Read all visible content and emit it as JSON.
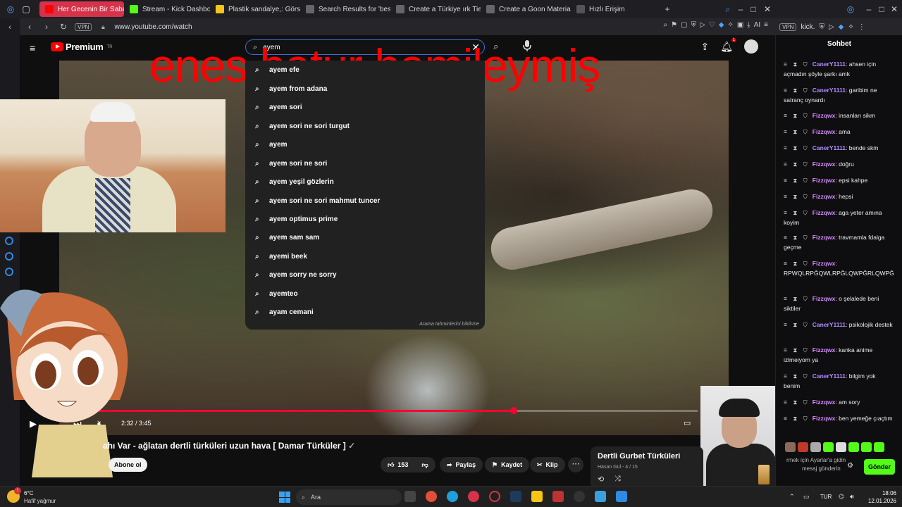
{
  "browser": {
    "tabs": [
      {
        "label": "Her Gecenin Bir Sabahı Va",
        "active": true,
        "color": "#ff0000"
      },
      {
        "label": "Stream - Kick Dashboard",
        "active": false,
        "color": "#53fc18"
      },
      {
        "label": "Plastik sandalye,: Görsell",
        "active": false,
        "color": "#f5c518"
      },
      {
        "label": "Search Results for 'best g",
        "active": false,
        "color": "#888888"
      },
      {
        "label": "Create a Türkiye ırk Tier L",
        "active": false,
        "color": "#888888"
      },
      {
        "label": "Create a Goon Material Fe",
        "active": false,
        "color": "#888888"
      },
      {
        "label": "Hızlı Erişim",
        "active": false,
        "color": "#888888"
      }
    ],
    "new_tab": "+",
    "vpn_label": "VPN",
    "url": "www.youtube.com/watch",
    "ai_label": "AI",
    "chat_url": "kick."
  },
  "youtube": {
    "logo_text": "Premium",
    "logo_sup": "TR",
    "search_value": "ayem",
    "notification_count": "1",
    "suggestions": [
      "ayem efe",
      "ayem from adana",
      "ayem sori",
      "ayem sori ne sori turgut",
      "ayem",
      "ayem sori ne sori",
      "ayem yeşil gözlerin",
      "ayem sori ne sori mahmut tuncer",
      "ayem optimus prime",
      "ayem sam sam",
      "ayemi beek",
      "ayem sorry ne sorry",
      "ayemteo",
      "ayam cemani"
    ],
    "suggestions_footer": "Arama tahminlerini bildirme",
    "overlay_text": "enes batur hamileymiş",
    "player": {
      "time": "2:32 / 3:45",
      "progress": 0.7
    },
    "video_title": "ahı Var - ağlatan dertli türküleri uzun hava [ Damar Türküler ]",
    "subscribe_label": "Abone ol",
    "like_count": "153",
    "share_label": "Paylaş",
    "save_label": "Kaydet",
    "clip_label": "Klip",
    "more_label": "⋯",
    "playlist": {
      "title": "Dertli Gurbet Türküleri",
      "subtitle": "Hasan Gül - 4 / 15"
    }
  },
  "chat": {
    "header": "Sohbet",
    "messages": [
      {
        "user": "CanerY1111",
        "text": "ahsen için açmadın şöyle şarkı amk"
      },
      {
        "user": "CanerY1111",
        "text": "garibim ne satranç oynardı"
      },
      {
        "user": "Fizzqwx",
        "text": "insanları sikm"
      },
      {
        "user": "Fizzqwx",
        "text": "ama"
      },
      {
        "user": "CanerY1111",
        "text": "bende skm"
      },
      {
        "user": "Fizzqwx",
        "text": "doğru"
      },
      {
        "user": "Fizzqwx",
        "text": "epsi kahpe"
      },
      {
        "user": "Fizzqwx",
        "text": "hepsi"
      },
      {
        "user": "Fizzqwx",
        "text": "aga yeter amına koyim"
      },
      {
        "user": "Fizzqwx",
        "text": "travmamla fdalga geçme"
      },
      {
        "user": "Fizzqwx",
        "text": "RPWQLRPĞQWLRPĞLQWPĞRLQWPĞ"
      },
      {
        "user": "Fizzqwx",
        "text": "o şelalede beni siktiler"
      },
      {
        "user": "CanerY1111",
        "text": "psikolojik destek"
      },
      {
        "user": "Fizzqwx",
        "text": "kanka anime izlmeiyom ya"
      },
      {
        "user": "CanerY1111",
        "text": "bilgim yok benim"
      },
      {
        "user": "Fizzqwx",
        "text": "am sory"
      },
      {
        "user": "Fizzqwx",
        "text": "ben yemeğe çıaçtım"
      }
    ],
    "input_lines": [
      "rmek için Ayarlar'a gidin",
      "mesaj gönderin"
    ],
    "send_label": "Gönder"
  },
  "taskbar": {
    "temperature": "6°C",
    "weather": "Hafif yağmur",
    "search_placeholder": "Ara",
    "language": "TUR",
    "time": "18:06",
    "date": "12.01.2026"
  }
}
